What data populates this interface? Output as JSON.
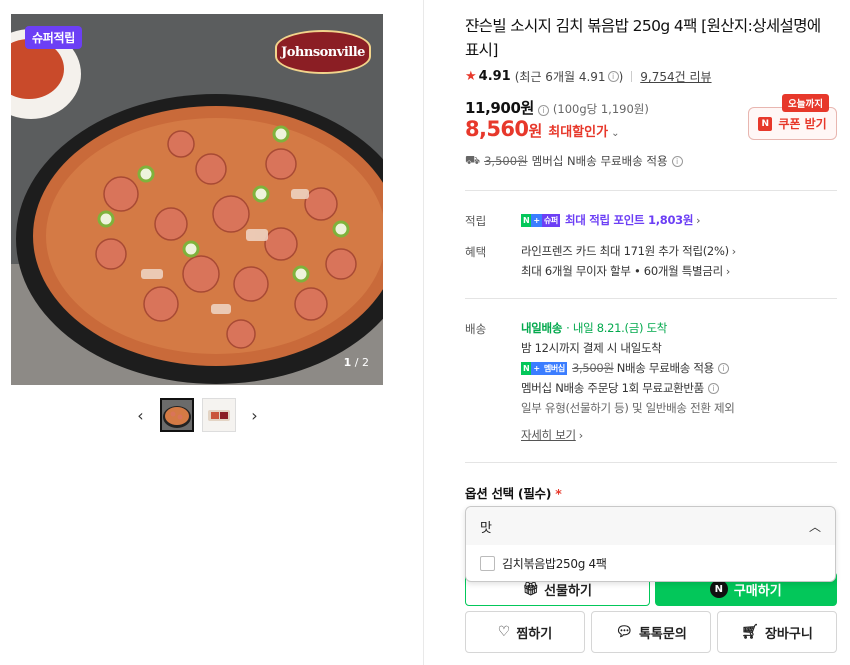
{
  "gallery": {
    "super_badge": "슈퍼적립",
    "brand_logo": "Johnsonville",
    "image_index": "1",
    "image_total": "/ 2",
    "prev_icon": "chevron-left-icon",
    "next_icon": "chevron-right-icon"
  },
  "product": {
    "title": "쟌슨빌 소시지 김치 볶음밥 250g 4팩 [원산지:상세설명에 표시]",
    "rating_score": "4.91",
    "rating_recent": "(최근 6개월 4.91",
    "rating_recent_close": ")",
    "review_count": "9,754건 리뷰",
    "original_price": "11,900원",
    "unit_price": "(100g당 1,190원)",
    "sale_price": "8,560",
    "sale_price_unit": "원",
    "sale_label": "최대할인가",
    "coupon_tag": "오늘까지",
    "coupon_label": "쿠폰 받기",
    "shipping_old": "3,500원",
    "shipping_text": "멤버십 N배송 무료배송 적용"
  },
  "benefits": {
    "points_label": "적립",
    "points_badge_tag": "슈퍼",
    "points_text": "최대 적립 포인트 1,803원",
    "perks_label": "혜택",
    "perk_line1": "라인프렌즈 카드 최대 171원 추가 적립(2%)",
    "perk_line2": "최대 6개월 무이자 할부 • 60개월 특별금리"
  },
  "delivery": {
    "label": "배송",
    "badge": "내일배송",
    "arrival": "· 내일 8.21.(금) 도착",
    "cutoff": "밤 12시까지 결제 시 내일도착",
    "membership_tag": "멤버십",
    "old_fee": "3,500원",
    "free_text": "N배송 무료배송 적용",
    "exchange": "멤버십 N배송 주문당 1회 무료교환반품",
    "note": "일부 유형(선물하기 등) 및 일반배송 전환 제외",
    "details_link": "자세히 보기"
  },
  "options": {
    "title": "옵션 선택 (필수)",
    "required_mark": "*",
    "selected": "맛",
    "items": [
      "김치볶음밥250g 4팩"
    ]
  },
  "actions": {
    "gift": "선물하기",
    "buy": "구매하기",
    "wish": "찜하기",
    "talk": "톡톡문의",
    "cart": "장바구니"
  },
  "colors": {
    "accent_red": "#e7382b",
    "naver_green": "#03c75a",
    "super_purple": "#6c3ff5"
  }
}
